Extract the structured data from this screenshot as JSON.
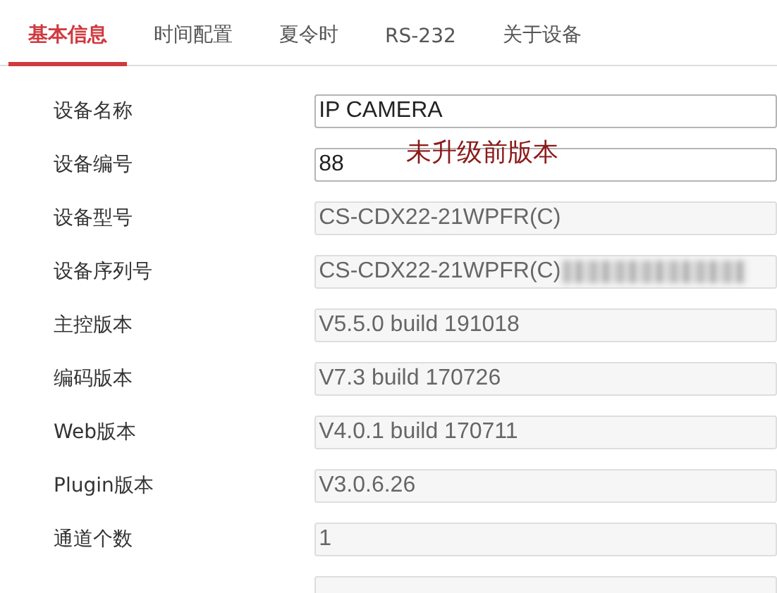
{
  "tabs": [
    {
      "label": "基本信息",
      "selected": true
    },
    {
      "label": "时间配置",
      "selected": false
    },
    {
      "label": "夏令时",
      "selected": false
    },
    {
      "label": "RS-232",
      "selected": false
    },
    {
      "label": "关于设备",
      "selected": false
    }
  ],
  "fields": [
    {
      "label": "设备名称",
      "value": "IP CAMERA",
      "editable": true
    },
    {
      "label": "设备编号",
      "value": "88",
      "editable": true
    },
    {
      "label": "设备型号",
      "value": "CS-CDX22-21WPFR(C)",
      "editable": false
    },
    {
      "label": "设备序列号",
      "value": "CS-CDX22-21WPFR(C)",
      "editable": false,
      "redacted": true
    },
    {
      "label": "主控版本",
      "value": "V5.5.0 build 191018",
      "editable": false
    },
    {
      "label": "编码版本",
      "value": "V7.3 build 170726",
      "editable": false
    },
    {
      "label": "Web版本",
      "value": "V4.0.1 build 170711",
      "editable": false
    },
    {
      "label": "Plugin版本",
      "value": "V3.0.6.26",
      "editable": false
    },
    {
      "label": "通道个数",
      "value": "1",
      "editable": false
    }
  ],
  "annotation": "未升级前版本"
}
